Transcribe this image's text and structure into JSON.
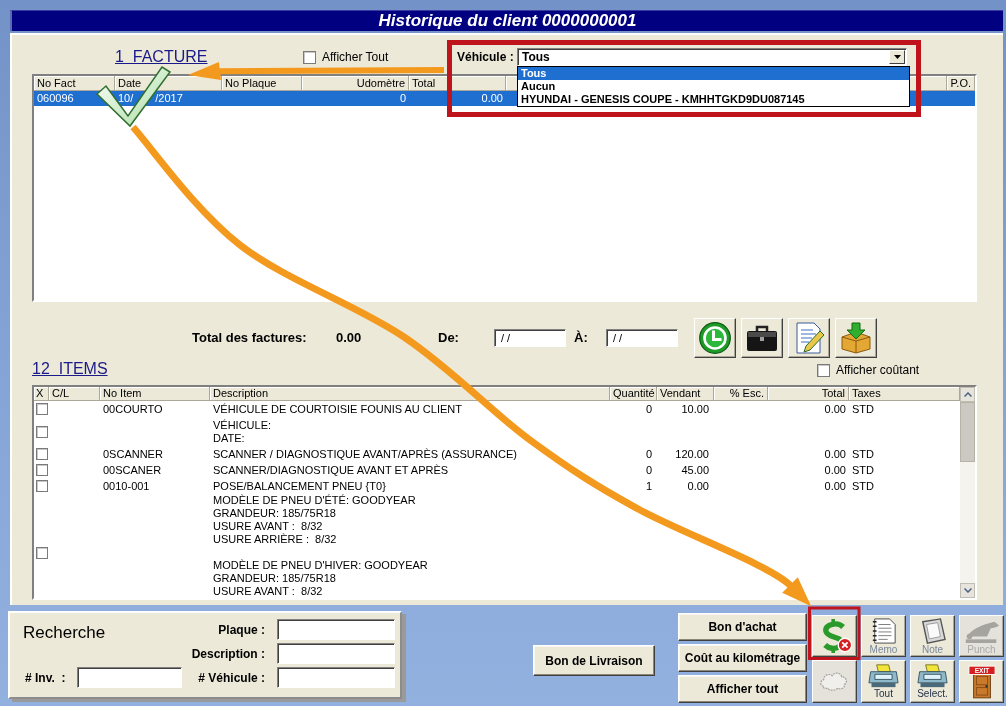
{
  "window": {
    "title": "Historique du client 0000000001"
  },
  "invoices": {
    "heading": "1  FACTURE",
    "show_all": {
      "label": "Afficher Tout",
      "checked": false
    },
    "vehicle": {
      "label": "Véhicule :",
      "value": "Tous",
      "expanded": true,
      "options": [
        {
          "label": "Tous",
          "selected": true
        },
        {
          "label": "Aucun",
          "selected": false
        },
        {
          "label": "HYUNDAI - GENESIS COUPE - KMHHTGKD9DU087145",
          "selected": false
        }
      ]
    },
    "columns": [
      "No Fact",
      "Date",
      "No Plaque",
      "Udomètre",
      "Total",
      "P.O."
    ],
    "rows": [
      {
        "no_fact": "060096",
        "date": [
          "10/",
          "/2017"
        ],
        "odometer": "0",
        "total": "0.00",
        "selected": true
      }
    ]
  },
  "summary": {
    "total_label": "Total des factures:",
    "total_value": "0.00",
    "from_label": "De:",
    "from_value": "/ /",
    "to_label": "À:",
    "to_value": "/ /"
  },
  "items": {
    "heading": "12  ITEMS",
    "show_cost": {
      "label": "Afficher coûtant",
      "checked": false
    },
    "columns": [
      "X",
      "C/L",
      "No Item",
      "Description",
      "Quantité",
      "Vendant",
      "% Esc.",
      "Total",
      "Taxes"
    ],
    "rows": [
      {
        "kind": "item",
        "checked": false,
        "no_item": "00COURTO",
        "description": [
          "VÉHICULE DE COURTOISIE FOUNIS AU CLIENT"
        ],
        "qty": "0",
        "price": "10.00",
        "total": "0.00",
        "tax": "STD"
      },
      {
        "kind": "item",
        "checked": false,
        "description": [
          "VÉHICULE:",
          "DATE:"
        ]
      },
      {
        "kind": "item",
        "checked": false,
        "no_item": "0SCANNER",
        "description": [
          "SCANNER / DIAGNOSTIQUE AVANT/APRÈS (ASSURANCE)"
        ],
        "qty": "0",
        "price": "120.00",
        "total": "0.00",
        "tax": "STD"
      },
      {
        "kind": "item",
        "checked": false,
        "no_item": "00SCANER",
        "description": [
          "SCANNER/DIAGNOSTIQUE AVANT ET APRÈS"
        ],
        "qty": "0",
        "price": "45.00",
        "total": "0.00",
        "tax": "STD"
      },
      {
        "kind": "item",
        "checked": false,
        "no_item": "0010-001",
        "description": [
          "POSE/BALANCEMENT PNEU {T0}"
        ],
        "qty": "1",
        "price": "0.00",
        "total": "0.00",
        "tax": "STD"
      },
      {
        "kind": "text",
        "description": [
          "MODÈLE DE PNEU D'ÉTÉ: GOODYEAR",
          "GRANDEUR: 185/75R18",
          "USURE AVANT :  8/32",
          "USURE ARRIÈRE :  8/32"
        ]
      },
      {
        "kind": "item",
        "checked": false
      },
      {
        "kind": "text",
        "description": [
          "MODÈLE DE PNEU D'HIVER: GOODYEAR",
          "GRANDEUR: 185/75R18",
          "USURE AVANT :  8/32"
        ]
      }
    ]
  },
  "search": {
    "title": "Recherche",
    "fields": [
      {
        "label": "Plaque :"
      },
      {
        "label": "Description :"
      },
      {
        "label": "# Véhicule :"
      }
    ],
    "invoice": {
      "label": "# Inv.  :"
    }
  },
  "delivery_button": "Bon de Livraison",
  "actions": [
    "Bon d'achat",
    "Coût au kilométrage",
    "Afficher tout"
  ],
  "toolbar": [
    {
      "kind": "dollar",
      "disabled": false
    },
    {
      "kind": "memo",
      "label": "Memo",
      "disabled": false
    },
    {
      "kind": "note",
      "label": "Note",
      "disabled": false
    },
    {
      "kind": "punch",
      "label": "Punch",
      "disabled": true
    },
    {
      "kind": "cloud",
      "disabled": true
    },
    {
      "kind": "printer",
      "label": "Tout",
      "disabled": false
    },
    {
      "kind": "printer",
      "label": "Select.",
      "disabled": false
    },
    {
      "kind": "exit",
      "sign": "EXIT",
      "disabled": false
    }
  ]
}
